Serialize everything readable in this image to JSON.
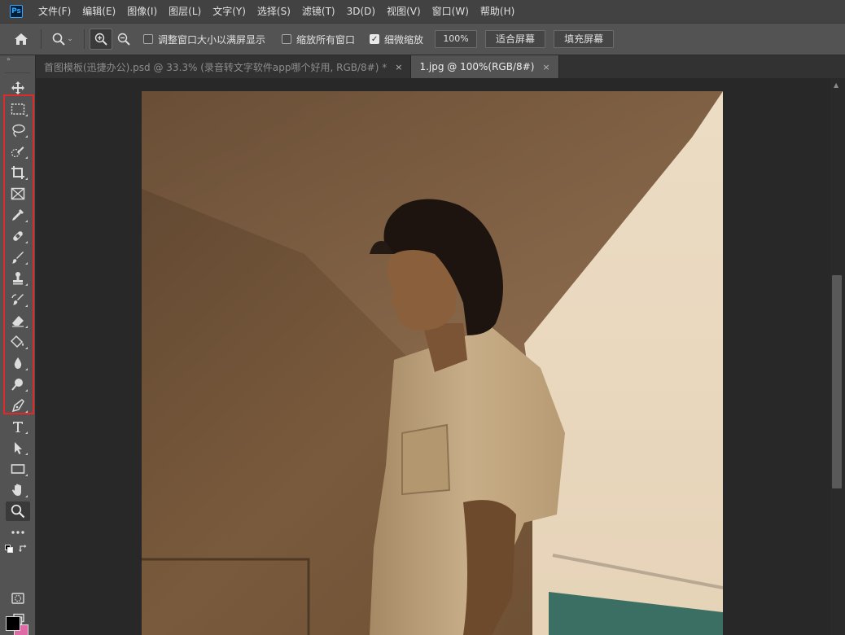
{
  "app": {
    "logo_text": "Ps"
  },
  "menu": {
    "items": [
      "文件(F)",
      "编辑(E)",
      "图像(I)",
      "图层(L)",
      "文字(Y)",
      "选择(S)",
      "滤镜(T)",
      "3D(D)",
      "视图(V)",
      "窗口(W)",
      "帮助(H)"
    ]
  },
  "options": {
    "resize_windows_label": "调整窗口大小以满屏显示",
    "resize_windows_checked": false,
    "zoom_all_label": "缩放所有窗口",
    "zoom_all_checked": false,
    "scrubby_zoom_label": "细微缩放",
    "scrubby_zoom_checked": true,
    "zoom_value": "100%",
    "fit_screen_label": "适合屏幕",
    "fill_screen_label": "填充屏幕"
  },
  "tabs": [
    {
      "label": "首图模板(迅捷办公).psd @ 33.3% (录音转文字软件app哪个好用, RGB/8#) *",
      "close": "×",
      "active": false
    },
    {
      "label": "1.jpg @ 100%(RGB/8#)",
      "close": "×",
      "active": true
    }
  ],
  "toolbar": {
    "tools": [
      "move-tool",
      "marquee-tool",
      "lasso-tool",
      "quick-selection-tool",
      "crop-tool",
      "frame-tool",
      "eyedropper-tool",
      "healing-brush-tool",
      "brush-tool",
      "clone-stamp-tool",
      "history-brush-tool",
      "eraser-tool",
      "paint-bucket-tool",
      "blur-tool",
      "dodge-tool",
      "pen-tool",
      "type-tool",
      "path-selection-tool",
      "rectangle-tool",
      "hand-tool",
      "zoom-tool"
    ],
    "active_tool": "zoom-tool",
    "highlight_color": "#e0292b",
    "foreground_color": "#000000",
    "background_color": "#e06aa6"
  },
  "colors": {
    "accent": "#31a8ff",
    "highlight": "#e0292b"
  }
}
